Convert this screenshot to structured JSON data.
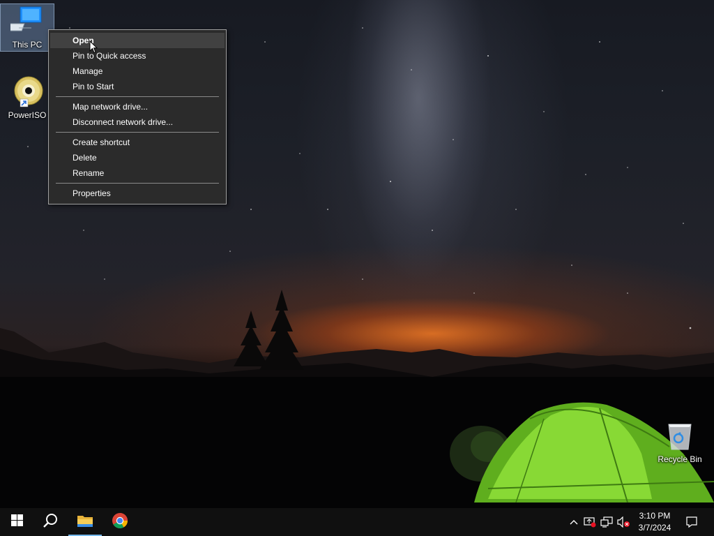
{
  "desktop": {
    "icons": [
      {
        "label": "This PC",
        "icon": "computer-icon"
      },
      {
        "label": "PowerISO",
        "icon": "disc-icon"
      },
      {
        "label": "Recycle Bin",
        "icon": "recycle-bin-icon"
      }
    ]
  },
  "context_menu": {
    "groups": [
      [
        {
          "label": "Open"
        },
        {
          "label": "Pin to Quick access"
        },
        {
          "label": "Manage"
        },
        {
          "label": "Pin to Start"
        }
      ],
      [
        {
          "label": "Map network drive..."
        },
        {
          "label": "Disconnect network drive..."
        }
      ],
      [
        {
          "label": "Create shortcut"
        },
        {
          "label": "Delete"
        },
        {
          "label": "Rename"
        }
      ],
      [
        {
          "label": "Properties"
        }
      ]
    ]
  },
  "taskbar": {
    "pinned": [
      "windows-start-icon",
      "search-icon",
      "file-explorer-icon",
      "chrome-icon"
    ],
    "tray": [
      "chevron-up-icon",
      "security-alert-icon",
      "network-icon",
      "volume-muted-icon"
    ],
    "clock": {
      "time": "3:10 PM",
      "date": "3/7/2024"
    },
    "notifications_icon": "action-center-icon"
  },
  "colors": {
    "menu_bg": "#2b2b2b",
    "menu_hover": "#414141",
    "taskbar_bg": "#101010",
    "active_indicator": "#76b9ed",
    "tent_green": "#8fe03a"
  }
}
